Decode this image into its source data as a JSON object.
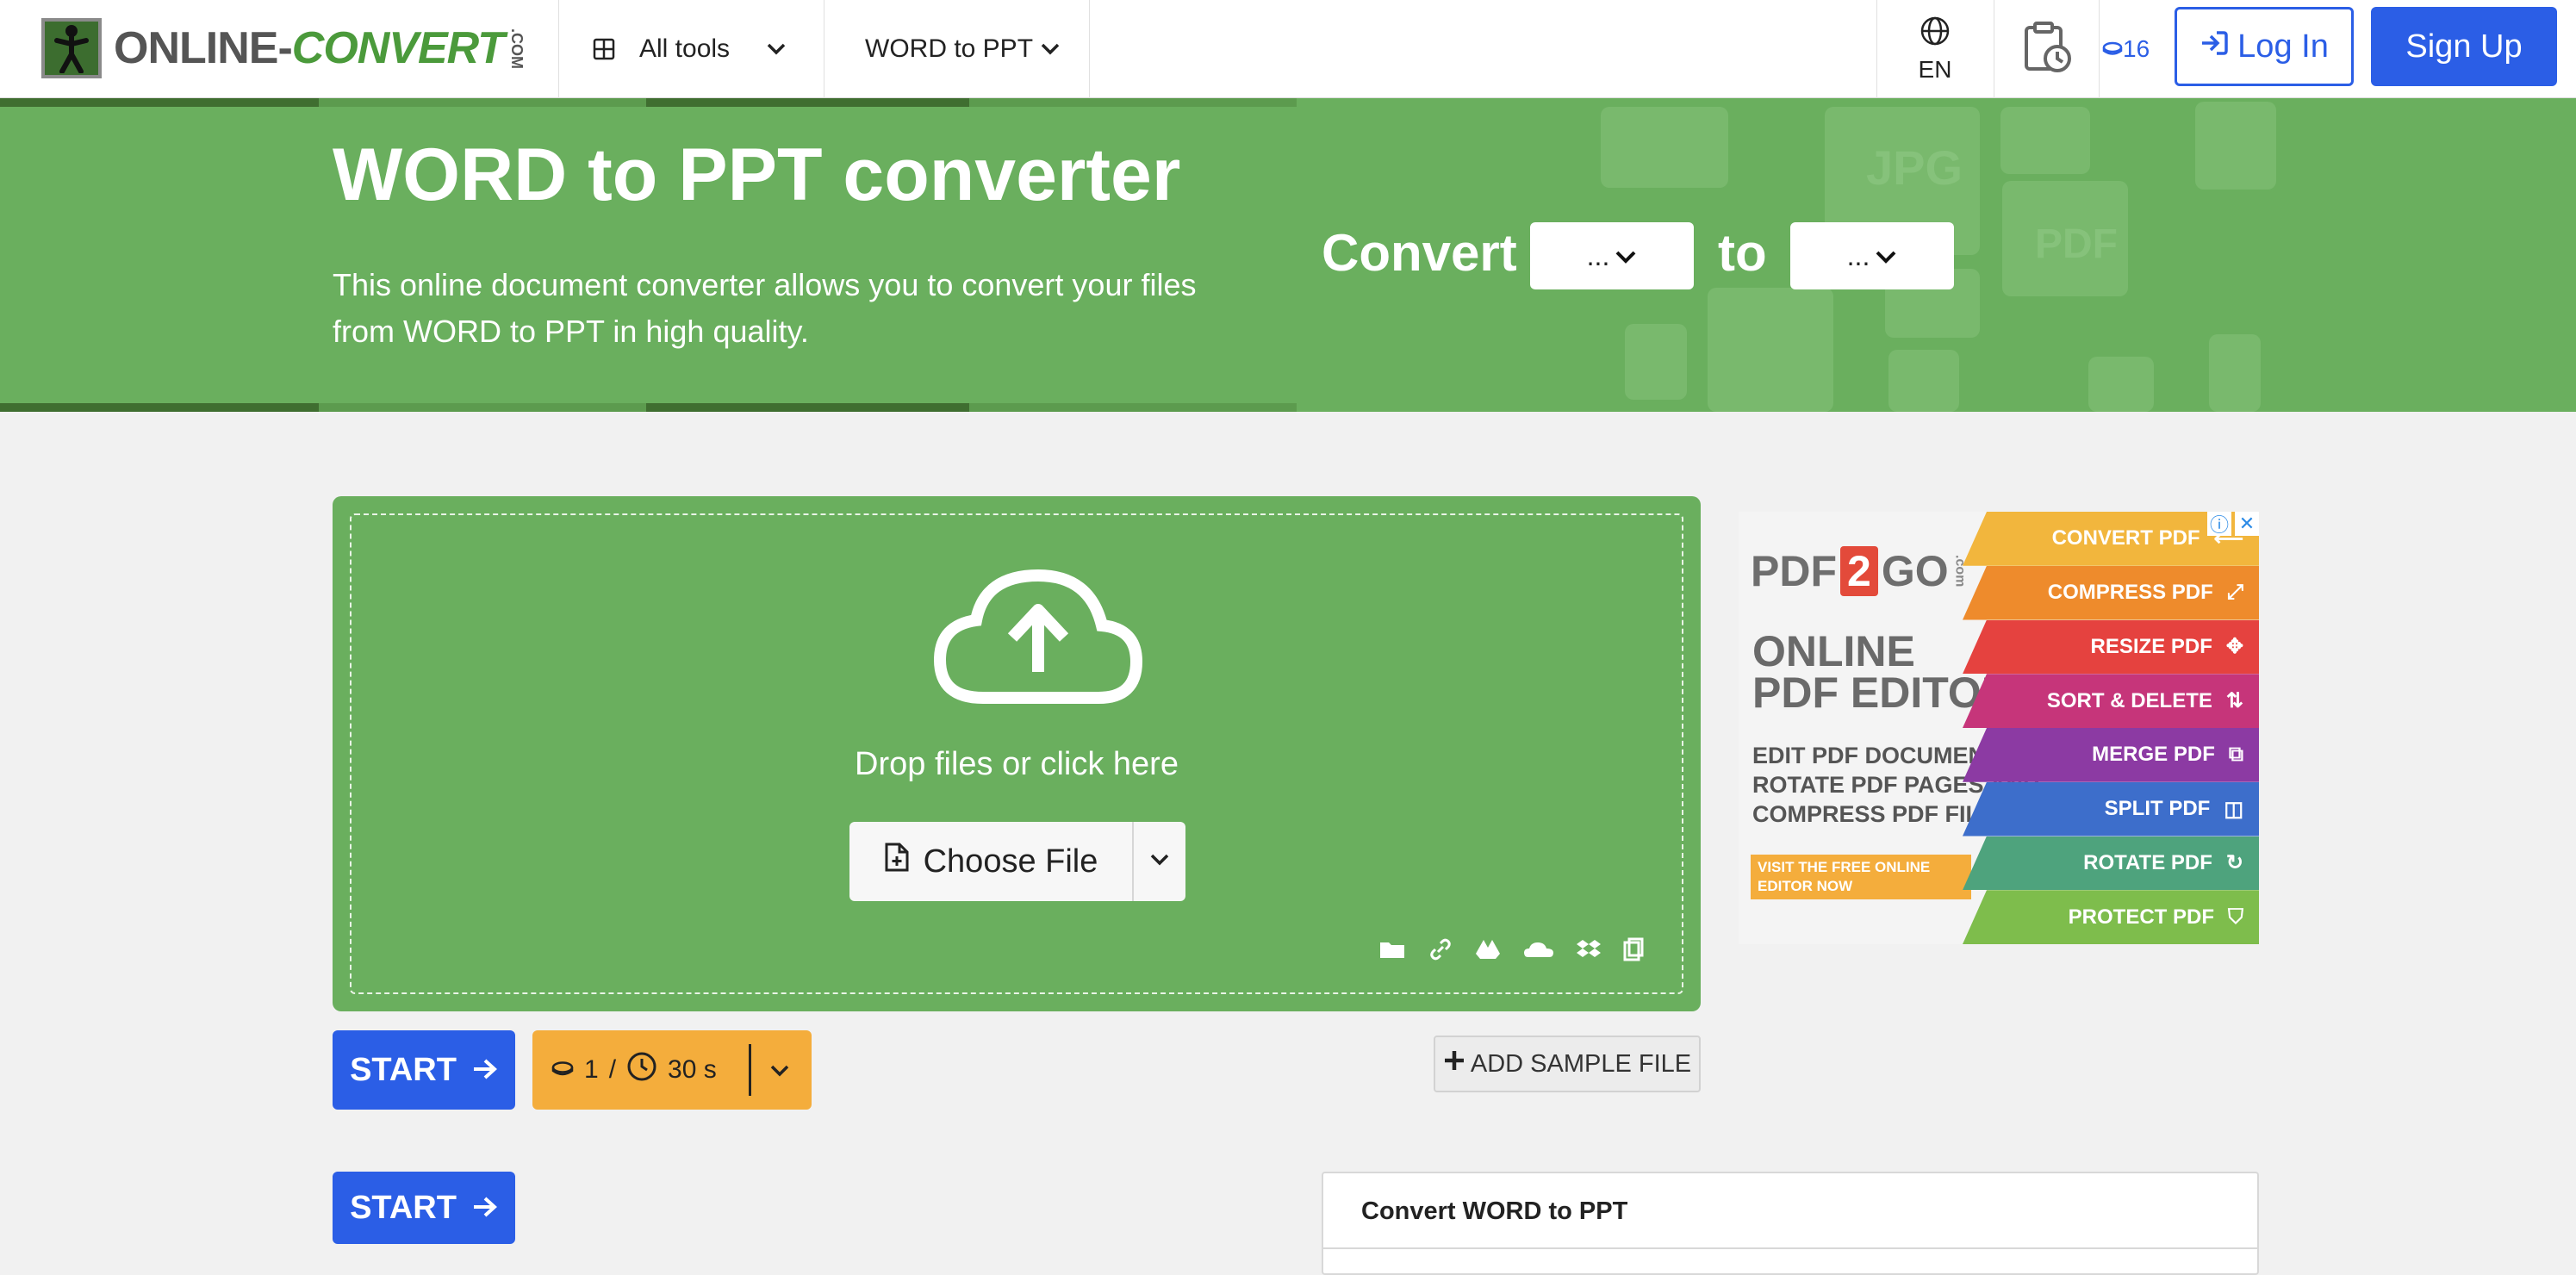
{
  "nav": {
    "logo_prefix": "ONLINE-",
    "logo_suffix": "CONVERT",
    "logo_com": ".COM",
    "all_tools": "All tools",
    "current_tool": "WORD to PPT",
    "language": "EN",
    "credits": "16",
    "login": "Log In",
    "signup": "Sign Up"
  },
  "hero": {
    "title": "WORD to PPT converter",
    "description": "This online document converter allows you to convert your files from WORD to PPT in high quality.",
    "convert_label": "Convert",
    "to_label": "to",
    "from_select": "...",
    "to_select": "..."
  },
  "upload": {
    "drop_text": "Drop files or click here",
    "choose_file": "Choose File",
    "sources": [
      "folder-icon",
      "link-icon",
      "google-drive-icon",
      "onedrive-icon",
      "dropbox-icon",
      "clipboard-icon"
    ]
  },
  "actions": {
    "start": "START",
    "credit_cost": "1",
    "separator": "/",
    "time_cost": "30 s",
    "add_sample": "ADD SAMPLE FILE",
    "start_bottom": "START"
  },
  "panel": {
    "title": "Convert WORD to PPT"
  },
  "ad": {
    "logo_left": "PDF",
    "logo_num": "2",
    "logo_right": "GO",
    "logo_com": ".com",
    "headline_1": "ONLINE",
    "headline_2": "PDF EDITOR",
    "sub_1": "EDIT PDF DOCUMENTS,",
    "sub_2": "ROTATE PDF PAGES AND",
    "sub_3": "COMPRESS PDF FILES",
    "cta_1": "VISIT THE FREE ONLINE",
    "cta_2": "EDITOR NOW",
    "menu": [
      {
        "label": "CONVERT PDF",
        "color": "#f2b63d"
      },
      {
        "label": "COMPRESS PDF",
        "color": "#ee8b2c"
      },
      {
        "label": "RESIZE PDF",
        "color": "#e5423f"
      },
      {
        "label": "SORT & DELETE",
        "color": "#c6357a"
      },
      {
        "label": "MERGE PDF",
        "color": "#8c3aa3"
      },
      {
        "label": "SPLIT PDF",
        "color": "#3d6ecb"
      },
      {
        "label": "ROTATE PDF",
        "color": "#4ea37d"
      },
      {
        "label": "PROTECT PDF",
        "color": "#7ebd4c"
      }
    ]
  },
  "colors": {
    "primary": "#2b5ee6",
    "hero_green": "#6aaf5e",
    "cost_orange": "#f4ad3c"
  }
}
